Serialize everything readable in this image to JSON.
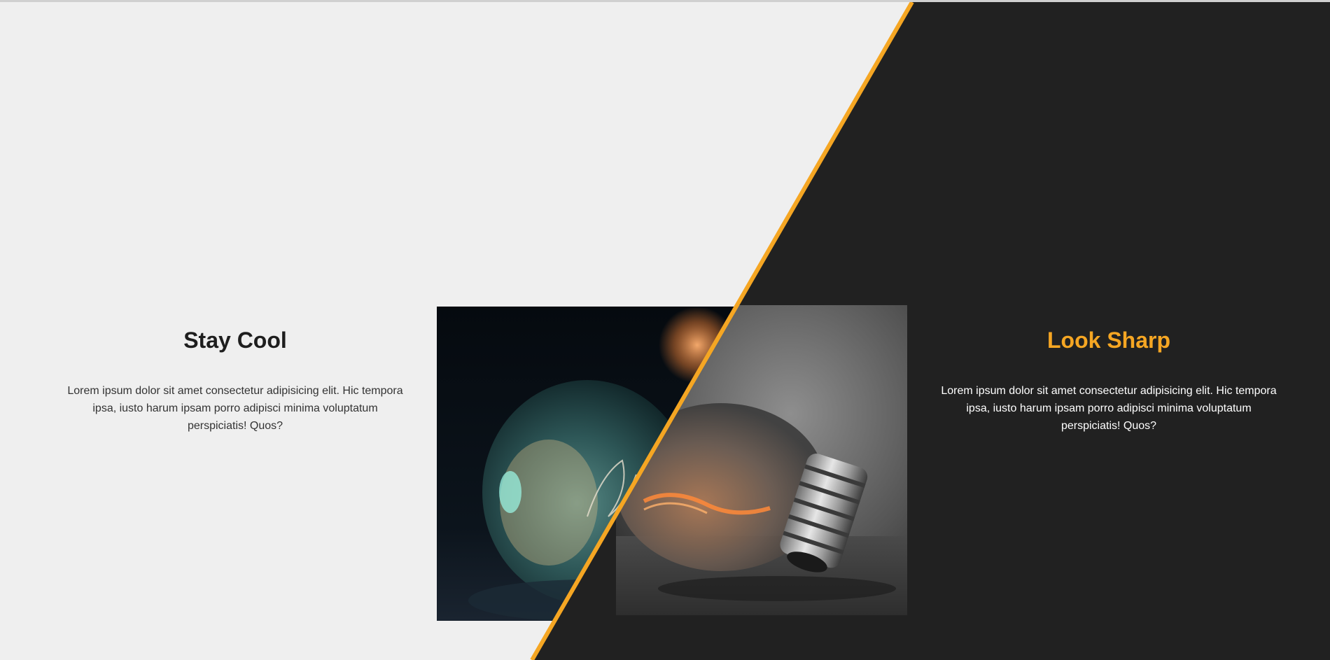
{
  "colors": {
    "light_bg": "#efefef",
    "dark_bg": "#212121",
    "accent": "#f5a623",
    "heading_dark": "#1e1e1e",
    "text_light": "#ffffff"
  },
  "left_panel": {
    "title": "Stay Cool",
    "body": "Lorem ipsum dolor sit amet consectetur adipisicing elit. Hic tempora ipsa, iusto harum ipsam porro adipisci minima voluptatum perspiciatis! Quos?"
  },
  "right_panel": {
    "title": "Look Sharp",
    "body": "Lorem ipsum dolor sit amet consectetur adipisicing elit. Hic tempora ipsa, iusto harum ipsam porro adipisci minima voluptatum perspiciatis! Quos?"
  },
  "images": {
    "left": "light-bulb-cool-photo",
    "right": "light-bulb-warm-photo"
  }
}
